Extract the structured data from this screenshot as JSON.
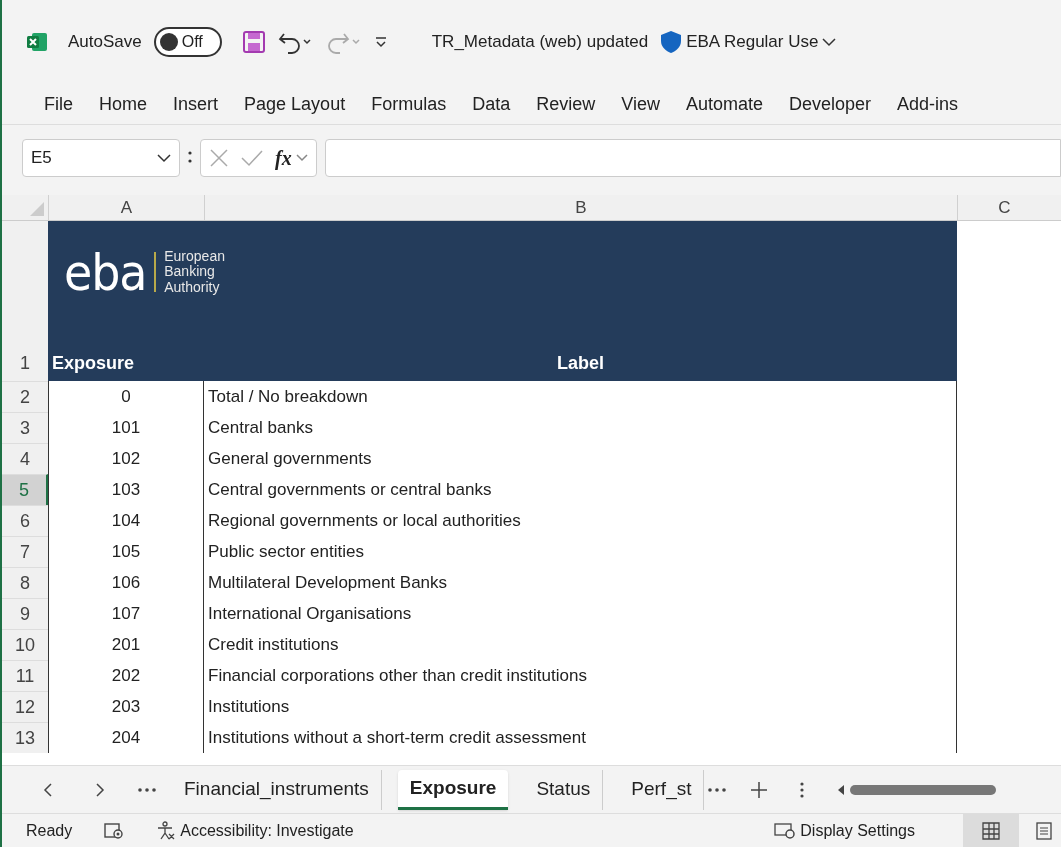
{
  "title_bar": {
    "autosave_label": "AutoSave",
    "autosave": {
      "on": false,
      "label": "Off"
    },
    "title": "TR_Metadata (web) updated",
    "sensitivity": "EBA Regular Use"
  },
  "ribbon_tabs": [
    "File",
    "Home",
    "Insert",
    "Page Layout",
    "Formulas",
    "Data",
    "Review",
    "View",
    "Automate",
    "Developer",
    "Add-ins"
  ],
  "formula_bar": {
    "name_box": "E5",
    "fx": "fx"
  },
  "columns": [
    "A",
    "B",
    "C"
  ],
  "logo": {
    "acronym": "eba",
    "lines": [
      "European",
      "Banking",
      "Authority"
    ]
  },
  "header_row": {
    "number": "1",
    "exposure": "Exposure",
    "label": "Label"
  },
  "rows": [
    {
      "number": "2",
      "exposure": "0",
      "label": "Total / No breakdown",
      "selected": false
    },
    {
      "number": "3",
      "exposure": "101",
      "label": "Central banks",
      "selected": false
    },
    {
      "number": "4",
      "exposure": "102",
      "label": "General governments",
      "selected": false
    },
    {
      "number": "5",
      "exposure": "103",
      "label": "Central governments or central banks",
      "selected": true
    },
    {
      "number": "6",
      "exposure": "104",
      "label": "Regional governments or local authorities",
      "selected": false
    },
    {
      "number": "7",
      "exposure": "105",
      "label": "Public sector entities",
      "selected": false
    },
    {
      "number": "8",
      "exposure": "106",
      "label": "Multilateral Development Banks",
      "selected": false
    },
    {
      "number": "9",
      "exposure": "107",
      "label": "International Organisations",
      "selected": false
    },
    {
      "number": "10",
      "exposure": "201",
      "label": "Credit institutions",
      "selected": false
    },
    {
      "number": "11",
      "exposure": "202",
      "label": "Financial corporations other than credit institutions",
      "selected": false
    },
    {
      "number": "12",
      "exposure": "203",
      "label": "Institutions",
      "selected": false
    },
    {
      "number": "13",
      "exposure": "204",
      "label": "Institutions without a short-term credit assessment",
      "selected": false
    }
  ],
  "sheet_tabs": [
    {
      "label": "Financial_instruments",
      "selected": false
    },
    {
      "label": "Exposure",
      "selected": true
    },
    {
      "label": "Status",
      "selected": false
    },
    {
      "label": "Perf_st",
      "selected": false
    }
  ],
  "status_bar": {
    "ready": "Ready",
    "accessibility": "Accessibility: Investigate",
    "display_settings": "Display Settings"
  }
}
